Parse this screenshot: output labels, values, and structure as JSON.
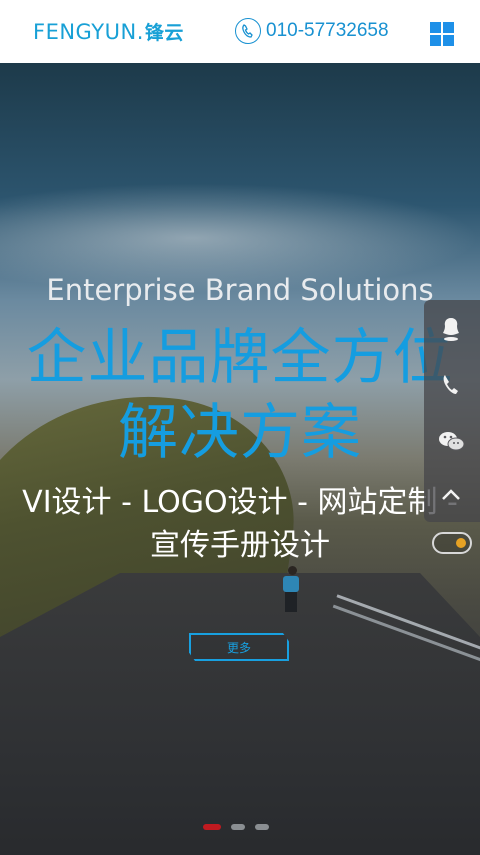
{
  "header": {
    "logo_latin": "FENGYUN.",
    "logo_cn": "锋云",
    "phone": "010-57732658",
    "menu_icon": "grid-menu-icon",
    "accent_color": "#18a0d6"
  },
  "banner": {
    "subtitle_en": "Enterprise Brand Solutions",
    "headline_line1": "企业品牌全方位",
    "headline_line2": "解决方案",
    "services_line1": "VI设计 - LOGO设计 - 网站定制 -",
    "services_line2": "宣传手册设计",
    "more_label": "更多",
    "slides": 3,
    "active_slide": 1
  },
  "side_tools": {
    "items": [
      "user-icon",
      "phone-icon",
      "wechat-icon",
      "back-to-top-icon"
    ]
  }
}
